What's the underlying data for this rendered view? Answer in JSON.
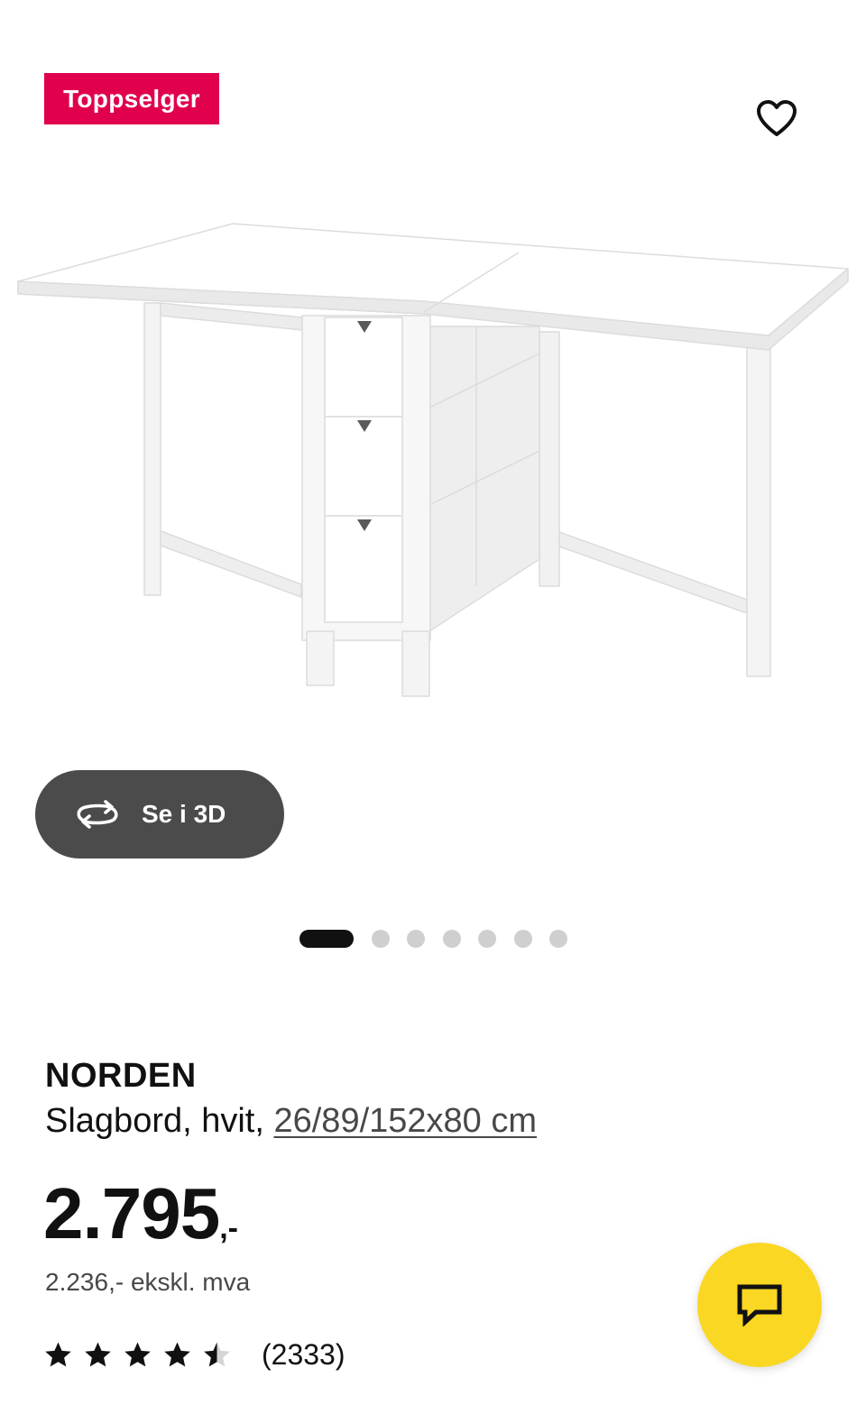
{
  "badge": {
    "label": "Toppselger",
    "color": "#e0004d"
  },
  "favourite": {
    "icon": "heart-outline-icon"
  },
  "viewer": {
    "label": "Se i 3D",
    "icon": "rotate-3d-icon"
  },
  "carousel": {
    "total": 7,
    "active": 1
  },
  "product": {
    "name": "NORDEN",
    "description_prefix": "Slagbord, hvit, ",
    "dimensions": "26/89/152x80 cm",
    "price_main": "2.795",
    "price_suffix": ",-",
    "price_ex_vat": "2.236,- ekskl. mva",
    "rating_value": 4.5,
    "rating_max": 5,
    "rating_count": "(2333)"
  },
  "chat": {
    "icon": "chat-icon",
    "color": "#fad723"
  }
}
